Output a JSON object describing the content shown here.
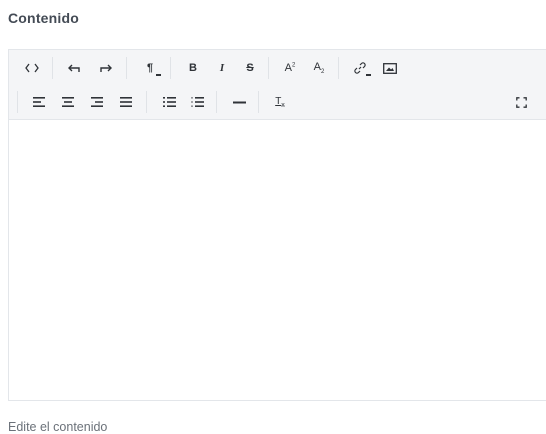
{
  "field": {
    "label": "Contenido",
    "help_text": "Edite el contenido",
    "content": ""
  },
  "toolbar": {
    "row1": [
      {
        "name": "code-view-icon",
        "title": "Código"
      },
      {
        "name": "undo-icon",
        "title": "Deshacer"
      },
      {
        "name": "redo-icon",
        "title": "Rehacer"
      },
      {
        "name": "paragraph-icon",
        "title": "Párrafo"
      },
      {
        "name": "bold-icon",
        "title": "Negrita"
      },
      {
        "name": "italic-icon",
        "title": "Cursiva"
      },
      {
        "name": "strikethrough-icon",
        "title": "Tachado"
      },
      {
        "name": "superscript-icon",
        "title": "Superíndice"
      },
      {
        "name": "subscript-icon",
        "title": "Subíndice"
      },
      {
        "name": "link-icon",
        "title": "Enlace"
      },
      {
        "name": "image-icon",
        "title": "Imagen"
      }
    ],
    "row2": [
      {
        "name": "align-left-icon",
        "title": "Alinear a la izquierda"
      },
      {
        "name": "align-center-icon",
        "title": "Centrar"
      },
      {
        "name": "align-right-icon",
        "title": "Alinear a la derecha"
      },
      {
        "name": "align-justify-icon",
        "title": "Justificar"
      },
      {
        "name": "unordered-list-icon",
        "title": "Lista"
      },
      {
        "name": "ordered-list-icon",
        "title": "Lista numerada"
      },
      {
        "name": "horizontal-rule-icon",
        "title": "Línea horizontal"
      },
      {
        "name": "clear-format-icon",
        "title": "Limpiar formato"
      },
      {
        "name": "fullscreen-icon",
        "title": "Pantalla completa"
      }
    ]
  },
  "colors": {
    "toolbar_bg": "#f4f5f7",
    "border": "#e3e6ea",
    "icon": "#2f3338",
    "label": "#444b55",
    "help": "#6b7179"
  }
}
